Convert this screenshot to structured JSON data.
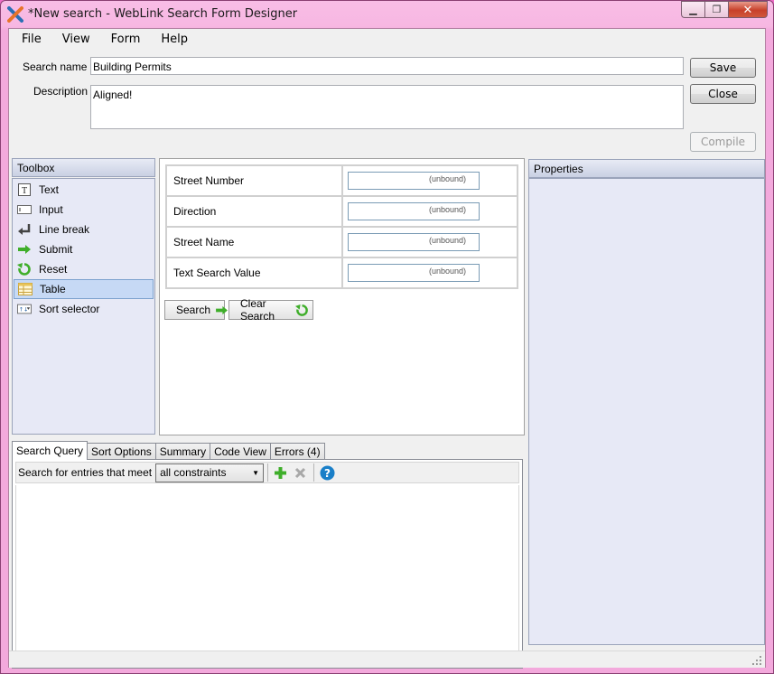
{
  "window": {
    "title": "*New search - WebLink Search Form Designer"
  },
  "menu": [
    "File",
    "View",
    "Form",
    "Help"
  ],
  "search_name": {
    "label": "Search name",
    "value": "Building Permits"
  },
  "description": {
    "label": "Description",
    "value": "Aligned!"
  },
  "buttons": {
    "save": "Save",
    "close": "Close",
    "compile": "Compile"
  },
  "toolbox": {
    "header": "Toolbox",
    "items": [
      {
        "label": "Text",
        "icon": "text-icon"
      },
      {
        "label": "Input",
        "icon": "input-icon"
      },
      {
        "label": "Line break",
        "icon": "line-break-icon"
      },
      {
        "label": "Submit",
        "icon": "submit-arrow-icon"
      },
      {
        "label": "Reset",
        "icon": "reset-icon"
      },
      {
        "label": "Table",
        "icon": "table-icon",
        "selected": true
      },
      {
        "label": "Sort selector",
        "icon": "sort-selector-icon"
      }
    ]
  },
  "form": {
    "rows": [
      {
        "label": "Street Number",
        "control": "(unbound)"
      },
      {
        "label": "Direction",
        "control": "(unbound)"
      },
      {
        "label": "Street Name",
        "control": "(unbound)"
      },
      {
        "label": "Text Search Value",
        "control": "(unbound)"
      }
    ],
    "search_button": "Search",
    "clear_button": "Clear Search"
  },
  "properties": {
    "header": "Properties"
  },
  "tabs": [
    "Search Query",
    "Sort Options",
    "Summary",
    "Code View",
    "Errors (4)"
  ],
  "query": {
    "prefix": "Search for entries that meet",
    "selected": "all constraints"
  },
  "colors": {
    "accent_green": "#3fae2a",
    "help_blue": "#1a7fc8",
    "selection": "#c6d9f5"
  }
}
